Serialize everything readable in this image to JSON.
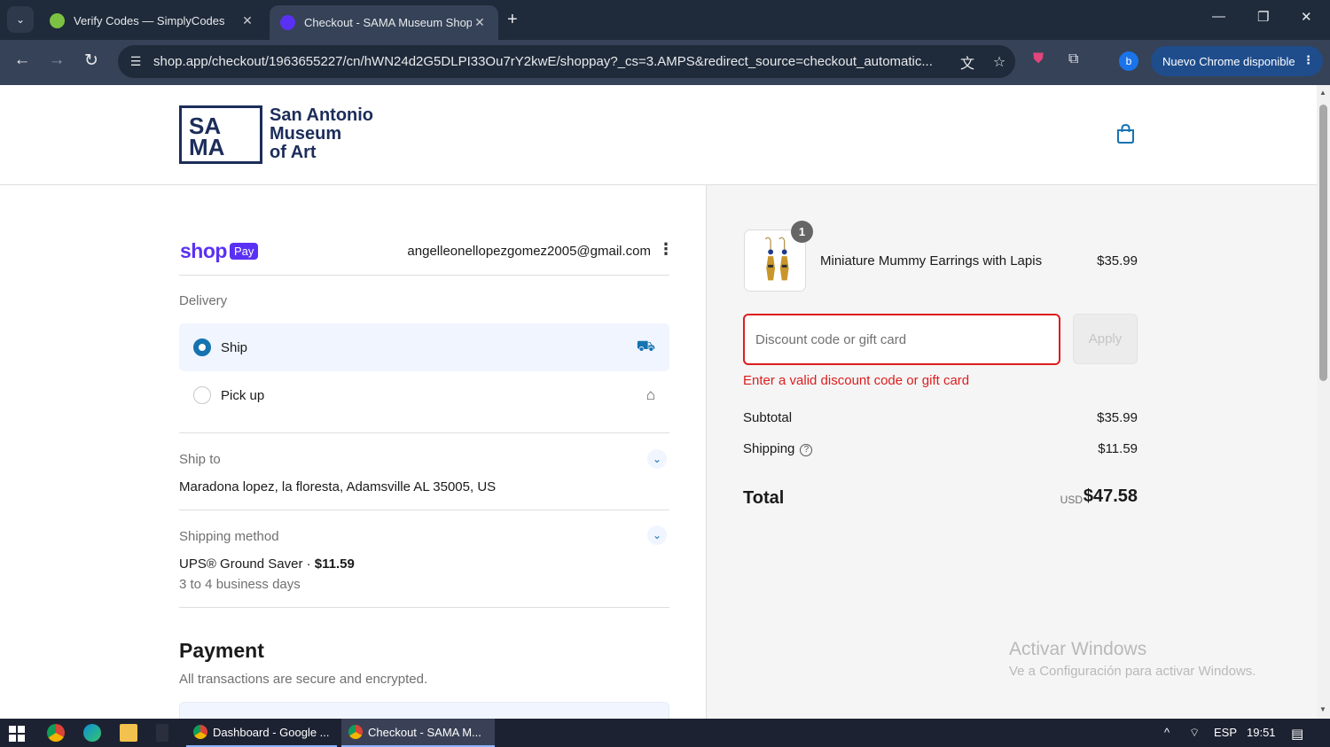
{
  "browser": {
    "tabs": [
      {
        "title": "Verify Codes — SimplyCodes",
        "favicon_color": "#7cc242",
        "active": false
      },
      {
        "title": "Checkout - SAMA Museum Shop",
        "favicon_color": "#5a31f4",
        "active": true
      }
    ],
    "url": "shop.app/checkout/1963655227/cn/hWN24d2G5DLPI33Ou7rY2kwE/shoppay?_cs=3.AMPS&redirect_source=checkout_automatic...",
    "profile_initial": "b",
    "update_label": "Nuevo Chrome disponible"
  },
  "store": {
    "logo_letters_top": "SA",
    "logo_letters_bottom": "MA",
    "name_line1": "San Antonio",
    "name_line2": "Museum",
    "name_line3": "of Art"
  },
  "checkout": {
    "shop_label": "shop",
    "pay_label": "Pay",
    "account_email": "angelleonellopezgomez2005@gmail.com",
    "delivery_label": "Delivery",
    "delivery_options": [
      {
        "label": "Ship",
        "selected": true
      },
      {
        "label": "Pick up",
        "selected": false
      }
    ],
    "ship_to_label": "Ship to",
    "ship_to_address": "Maradona lopez, la floresta, Adamsville AL 35005, US",
    "shipping_method_label": "Shipping method",
    "shipping_method_name": "UPS® Ground Saver · ",
    "shipping_method_price": "$11.59",
    "shipping_method_eta": "3 to 4 business days",
    "payment_title": "Payment",
    "payment_subtitle": "All transactions are secure and encrypted."
  },
  "summary": {
    "item_qty": "1",
    "item_name": "Miniature Mummy Earrings with Lapis",
    "item_price": "$35.99",
    "discount_placeholder": "Discount code or gift card",
    "apply_label": "Apply",
    "discount_error": "Enter a valid discount code or gift card",
    "subtotal_label": "Subtotal",
    "subtotal_value": "$35.99",
    "shipping_label": "Shipping",
    "shipping_value": "$11.59",
    "total_label": "Total",
    "total_currency": "USD",
    "total_value": "$47.58"
  },
  "watermark": {
    "line1": "Activar Windows",
    "line2": "Ve a Configuración para activar Windows."
  },
  "taskbar": {
    "apps": [
      {
        "label": "Dashboard - Google ..."
      },
      {
        "label": "Checkout - SAMA M..."
      }
    ],
    "language": "ESP",
    "time": "19:51"
  },
  "colors": {
    "accent": "#1773b0",
    "shop_pay": "#5a31f4",
    "error": "#dd1d1d",
    "brand_navy": "#1c2d5a"
  }
}
